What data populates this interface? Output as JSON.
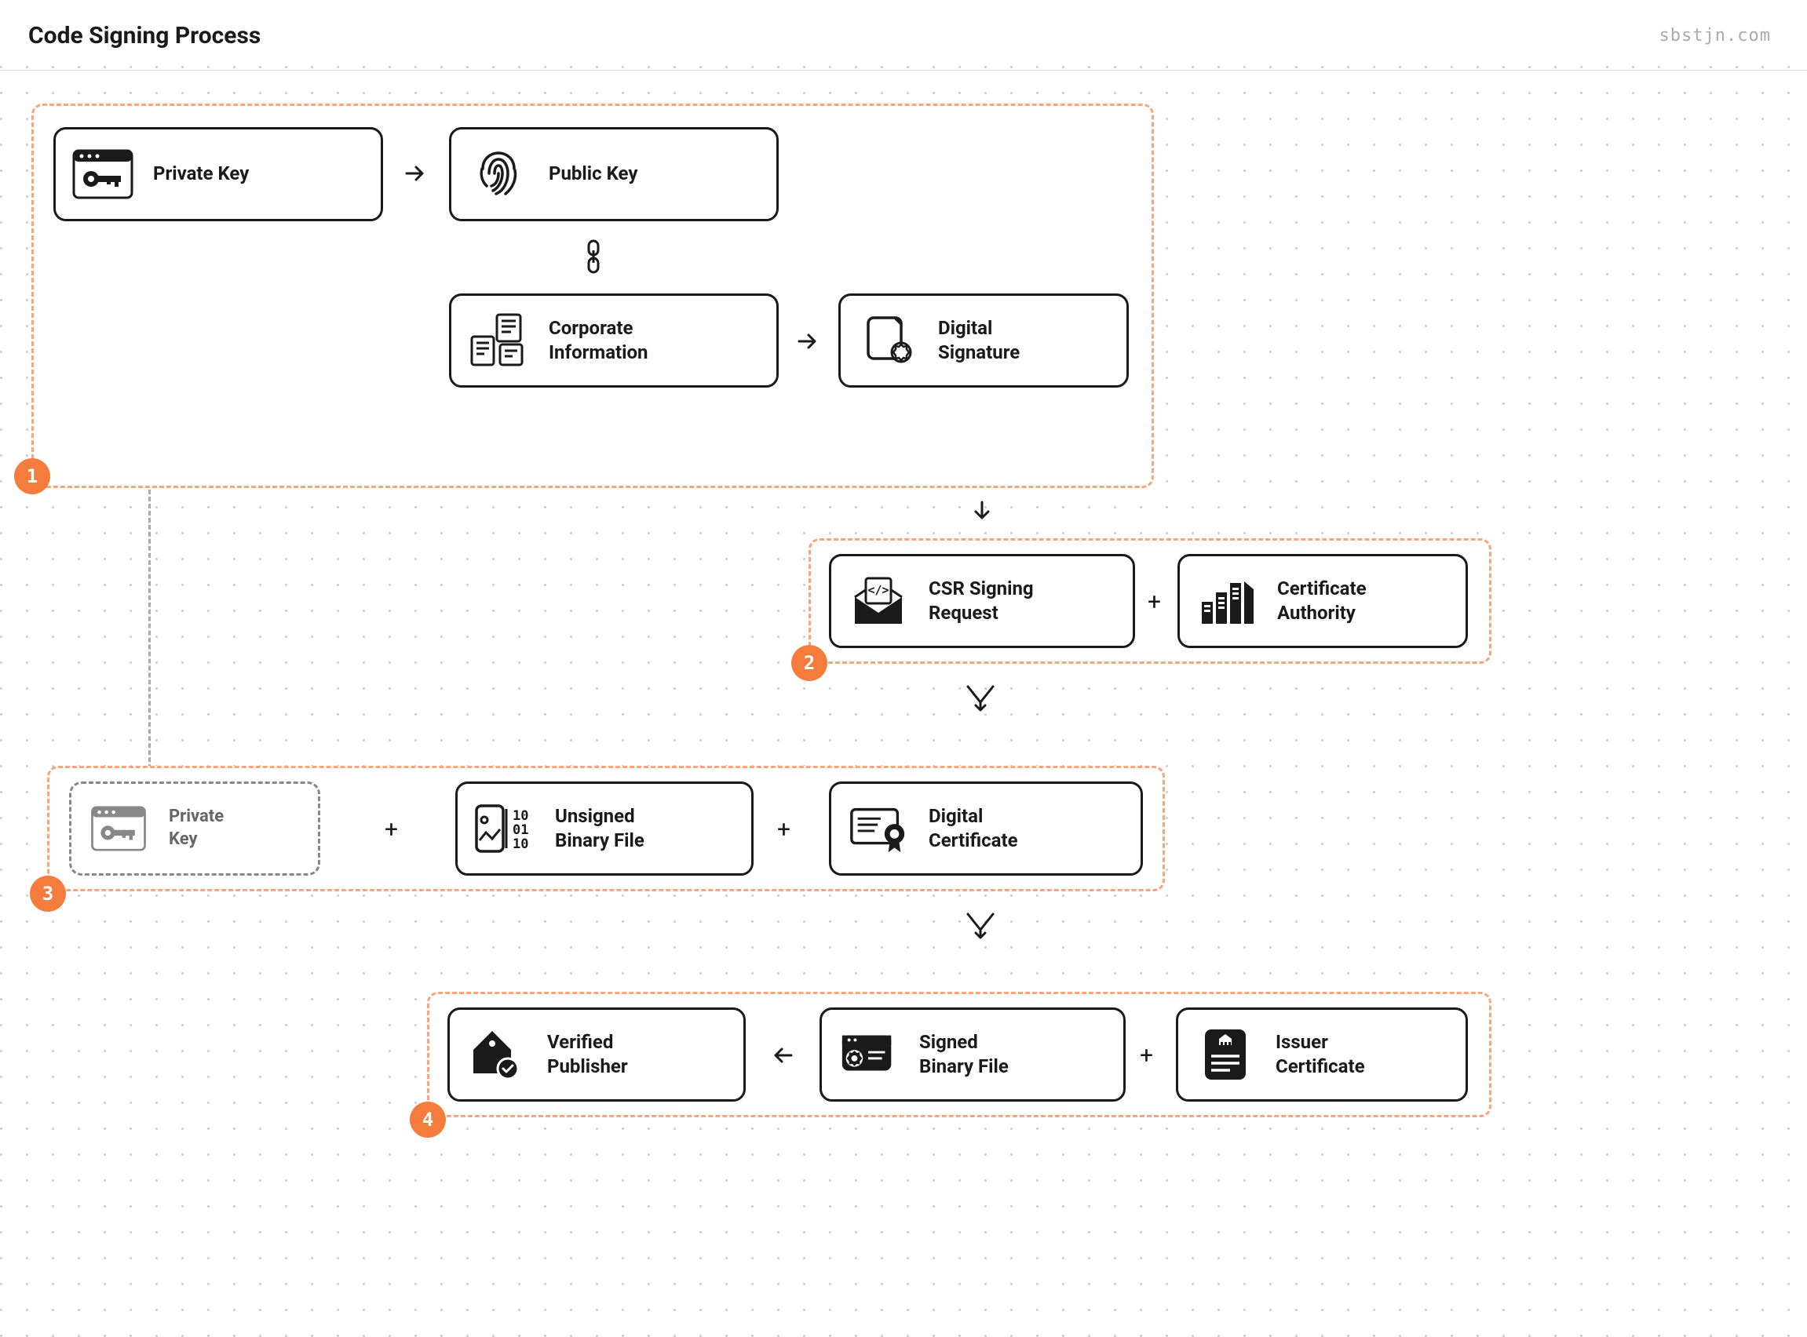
{
  "header": {
    "title": "Code Signing Process",
    "watermark": "sbstjn.com"
  },
  "groups": {
    "g1": {
      "badge": "1"
    },
    "g2": {
      "badge": "2"
    },
    "g3": {
      "badge": "3"
    },
    "g4": {
      "badge": "4"
    }
  },
  "nodes": {
    "private_key": "Private Key",
    "public_key": "Public Key",
    "corporate_info_l1": "Corporate",
    "corporate_info_l2": "Information",
    "digital_signature_l1": "Digital",
    "digital_signature_l2": "Signature",
    "csr_l1": "CSR Signing",
    "csr_l2": "Request",
    "ca_l1": "Certificate",
    "ca_l2": "Authority",
    "private_key_ghost_l1": "Private",
    "private_key_ghost_l2": "Key",
    "unsigned_l1": "Unsigned",
    "unsigned_l2": "Binary File",
    "digital_cert_l1": "Digital",
    "digital_cert_l2": "Certificate",
    "verified_l1": "Verified",
    "verified_l2": "Publisher",
    "signed_l1": "Signed",
    "signed_l2": "Binary File",
    "issuer_l1": "Issuer",
    "issuer_l2": "Certificate"
  },
  "symbols": {
    "plus": "+"
  }
}
